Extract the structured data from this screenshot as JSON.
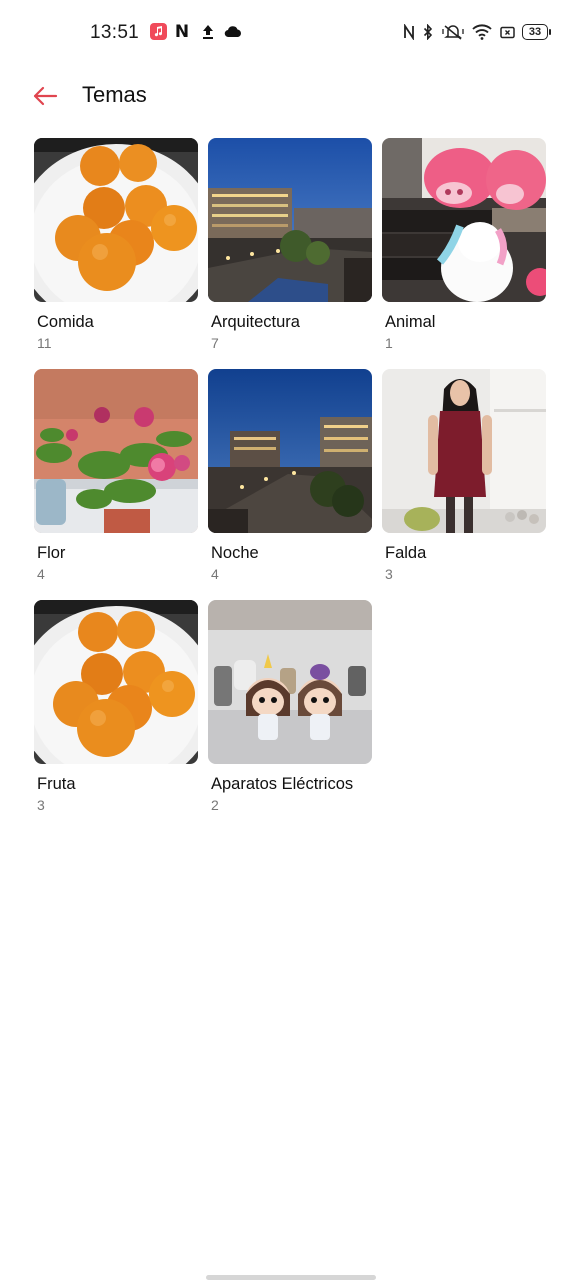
{
  "status_bar": {
    "time": "13:51",
    "battery": "33",
    "notification_icons": [
      "music-app-icon",
      "netflix-icon",
      "upload-icon",
      "cloud-icon"
    ],
    "system_icons": [
      "nfc-icon",
      "bluetooth-icon",
      "mute-vibrate-icon",
      "wifi-icon",
      "screen-cast-icon",
      "battery-icon"
    ]
  },
  "header": {
    "title": "Temas",
    "back_icon": "arrow-left-icon",
    "accent_color": "#e0454f"
  },
  "topics": [
    {
      "name": "Comida",
      "count": "11",
      "thumbnail": "oranges-on-plate"
    },
    {
      "name": "Arquitectura",
      "count": "7",
      "thumbnail": "city-street-dusk"
    },
    {
      "name": "Animal",
      "count": "1",
      "thumbnail": "plush-pigs-and-unicorn"
    },
    {
      "name": "Flor",
      "count": "4",
      "thumbnail": "pink-flowers-plant"
    },
    {
      "name": "Noche",
      "count": "4",
      "thumbnail": "night-city-view"
    },
    {
      "name": "Falda",
      "count": "3",
      "thumbnail": "woman-in-red-dress"
    },
    {
      "name": "Fruta",
      "count": "3",
      "thumbnail": "oranges-on-plate"
    },
    {
      "name": "Aparatos Eléctricos",
      "count": "2",
      "thumbnail": "funko-figures"
    }
  ]
}
